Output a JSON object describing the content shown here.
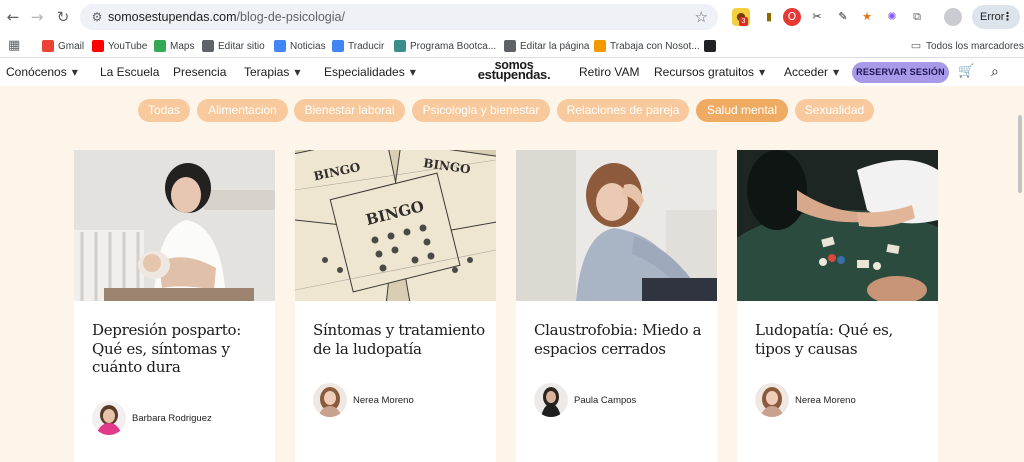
{
  "browser": {
    "url_domain": "somosestupendas.com",
    "url_path": "/blog-de-psicologia/",
    "ext_badge_1": "3",
    "error_label": "Error",
    "bookmarks": [
      {
        "label": "Gmail",
        "icon": "gmail-icon",
        "color": "#ea4335"
      },
      {
        "label": "YouTube",
        "icon": "youtube-icon",
        "color": "#ff0000"
      },
      {
        "label": "Maps",
        "icon": "maps-icon",
        "color": "#34a853"
      },
      {
        "label": "Editar sitio",
        "icon": "site-edit-icon",
        "color": "#5f6368"
      },
      {
        "label": "Noticias",
        "icon": "news-icon",
        "color": "#4285f4"
      },
      {
        "label": "Traducir",
        "icon": "translate-icon",
        "color": "#4285f4"
      },
      {
        "label": "Programa Bootca...",
        "icon": "bootcamp-icon",
        "color": "#3a8f8a"
      },
      {
        "label": "Editar la página",
        "icon": "pin-icon",
        "color": "#5f6368"
      },
      {
        "label": "Trabaja con Nosot...",
        "icon": "work-icon",
        "color": "#f29900"
      },
      {
        "label": "",
        "icon": "fs-icon",
        "color": "#202124"
      }
    ],
    "all_bookmarks": "Todos los marcadores"
  },
  "site": {
    "logo_line1": "somos",
    "logo_line2": "estupendas.",
    "menu": {
      "conocenos": "Conócenos",
      "escuela": "La Escuela",
      "presencia": "Presencia",
      "terapias": "Terapias",
      "especialidades": "Especialidades",
      "retiro": "Retiro VAM",
      "recursos": "Recursos gratuitos",
      "acceder": "Acceder"
    },
    "cta": "RESERVAR SESIÓN"
  },
  "filters": [
    {
      "label": "Todas",
      "active": false
    },
    {
      "label": "Alimentacion",
      "active": false
    },
    {
      "label": "Bienestar laboral",
      "active": false
    },
    {
      "label": "Psicologia y bienestar",
      "active": false
    },
    {
      "label": "Relaciones de pareja",
      "active": false
    },
    {
      "label": "Salud mental",
      "active": true
    },
    {
      "label": "Sexualidad",
      "active": false
    }
  ],
  "posts": [
    {
      "title": "Depresión posparto: Qué es, síntomas y cuánto dura",
      "author": "Barbara Rodriguez"
    },
    {
      "title": "Síntomas y tratamiento de la ludopatía",
      "author": "Nerea Moreno"
    },
    {
      "title": "Claustrofobia: Miedo a espacios cerrados",
      "author": "Paula Campos"
    },
    {
      "title": "Ludopatía: Qué es, tipos y causas",
      "author": "Nerea Moreno"
    }
  ],
  "colors": {
    "page_bg": "#fdf4ea",
    "chip": "#f7c99d",
    "chip_active": "#f0ab62",
    "cta": "#a89ae8"
  }
}
